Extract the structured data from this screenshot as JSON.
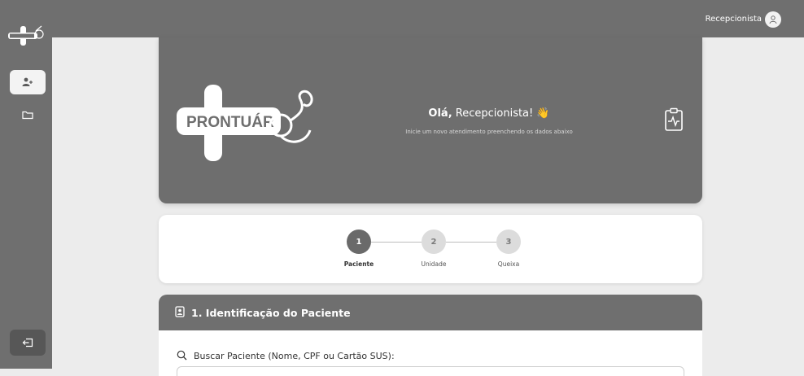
{
  "app": {
    "logo_text": "PRONTUÁRIO"
  },
  "header": {
    "user_name": "Recepcionista"
  },
  "sidebar": {
    "items": [
      {
        "name": "add-patient",
        "icon": "user-plus-icon",
        "active": true
      },
      {
        "name": "records",
        "icon": "folder-icon",
        "active": false
      }
    ],
    "logout_icon": "logout-icon"
  },
  "hero": {
    "greeting_prefix": "Olá,",
    "greeting_name": "Recepcionista!",
    "greeting_emoji": "👋",
    "subtitle": "Inicie um novo atendimento preenchendo os dados abaixo"
  },
  "stepper": {
    "steps": [
      {
        "number": "1",
        "label": "Paciente"
      },
      {
        "number": "2",
        "label": "Unidade"
      },
      {
        "number": "3",
        "label": "Queixa"
      }
    ],
    "current_step": 1
  },
  "section": {
    "title": "1. Identificação do Paciente",
    "search_label": "Buscar Paciente (Nome, CPF ou Cartão SUS):",
    "search_value": ""
  },
  "colors": {
    "primary": "#6f6f6f",
    "background": "#ececec",
    "card": "#ffffff"
  }
}
